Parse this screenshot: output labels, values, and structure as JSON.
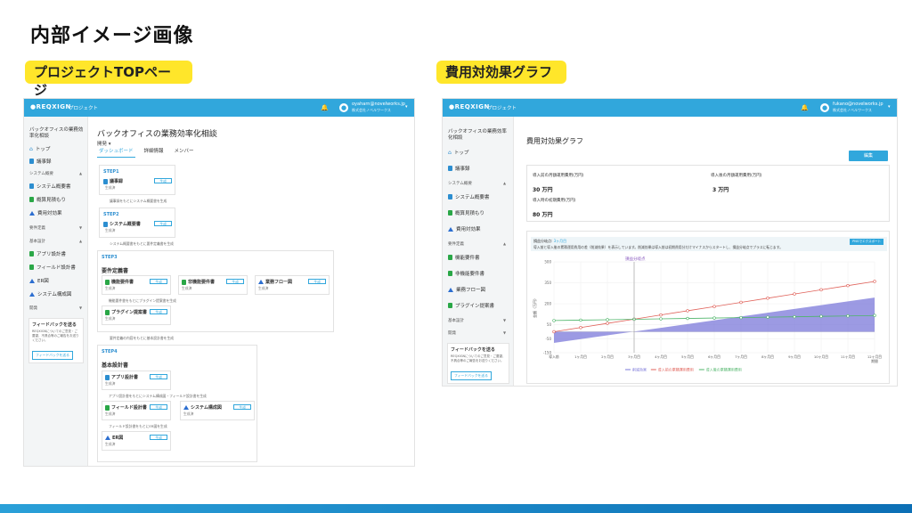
{
  "slide": {
    "title": "内部イメージ画像",
    "label_left": "プロジェクトTOPページ",
    "label_right": "費用対効果グラフ"
  },
  "app": {
    "logo": "REQXIGN",
    "header_project": "プロジェクト",
    "left_user_email": "oyaharn@novelworks.jp",
    "left_user_org": "株式会社ノベルワークス",
    "right_user_email": "fukano@novelworks.jp",
    "right_user_org": "株式会社ノベルワークス",
    "accent": "#31a7dc"
  },
  "left": {
    "sidebar": {
      "project": "バックオフィスの業務効率化相談",
      "items": [
        "トップ",
        "議事録"
      ],
      "section_system": "システム概要",
      "system_items": [
        "システム概要書",
        "概算見積もり",
        "費用対効果"
      ],
      "section_req": "要件定義",
      "section_basic": "基本設計",
      "basic_items": [
        "アプリ設計書",
        "フィールド設計書",
        "ER図",
        "システム構成図"
      ],
      "section_dev": "開発",
      "feedback_title": "フィードバックを送る",
      "feedback_text": "REQXIGNについてのご意見・ご要望、不具合等のご報告をお送りください。",
      "feedback_button": "フィードバックを送る"
    },
    "main": {
      "title": "バックオフィスの業務効率化相談",
      "stage": "開発 ▾",
      "tabs": [
        "ダッシュボード",
        "詳細情報",
        "メンバー"
      ],
      "step1": "STEP1",
      "step1_doc": "議事録",
      "step2": "STEP2",
      "step2_doc": "システム概要書",
      "step3": "STEP3",
      "step3_name": "要件定義書",
      "step3_docs": [
        "機能要件書",
        "非機能要件書",
        "業務フロー図"
      ],
      "step3_doc4": "プラグイン提案書",
      "step4": "STEP4",
      "step4_name": "基本設計書",
      "step4_docs": [
        "アプリ設計書",
        "フィールド設計書",
        "システム構成図",
        "ER図"
      ],
      "status": "生成済",
      "generate": "生成",
      "note1": "議事録をもとにシステム概要書を生成",
      "note2": "システム概要書をもとに要件定義書を生成",
      "note3": "機能要件書をもとにプラグイン提案書を生成",
      "note4": "要件定義の内容をもとに基本設計書を生成",
      "note5": "アプリ設計書をもとにシステム構成図・フィールド設計書を生成",
      "note6": "フィールド設計書をもとにER図を生成"
    }
  },
  "right": {
    "sidebar": {
      "project": "バックオフィスの業務効率化相談",
      "items": [
        "トップ",
        "議事録"
      ],
      "section_system": "システム概要",
      "system_items": [
        "システム概要書",
        "概算見積もり",
        "費用対効果"
      ],
      "section_req": "要件定義",
      "req_items": [
        "機能要件書",
        "非機能要件書",
        "業務フロー図",
        "プラグイン提案書"
      ],
      "section_basic": "基本設計",
      "section_dev": "開発",
      "feedback_title": "フィードバックを送る",
      "feedback_text": "REQXIGNについてのご意見・ご要望、不具合等のご報告をお送りください。",
      "feedback_button": "フィードバックを送る"
    },
    "main": {
      "title": "費用対効果グラフ",
      "edit_button": "編集",
      "before_label": "導入前の月額運用費用(万円)",
      "before_value": "30 万円",
      "after_label": "導入後の月額運用費用(万円)",
      "after_value": "3 万円",
      "initial_label": "導入時の初期費用(万円)",
      "initial_value": "80 万円",
      "breakeven_label": "損益分岐点:",
      "breakeven_value": "3ヶ月目",
      "info_text": "導入前と導入後の累積運用費用の差（削減効果）を表示しています。削減効果は導入前は初期費用分だけマイナスからスタートし、損益分岐点でプラスに転じます。",
      "png_button": "PNGでエクスポート"
    }
  },
  "chart_data": {
    "type": "line",
    "title": "",
    "annotation": "損益分岐点",
    "ylabel": "金額（万円）",
    "xlabel": "期間",
    "ylim": [
      -150,
      500
    ],
    "yticks": [
      "500",
      "350",
      "200",
      "50",
      "-50",
      "-150"
    ],
    "categories": [
      "導入前",
      "1ヶ月目",
      "2ヶ月目",
      "3ヶ月目",
      "4ヶ月目",
      "5ヶ月目",
      "6ヶ月目",
      "7ヶ月目",
      "8ヶ月目",
      "9ヶ月目",
      "10ヶ月目",
      "11ヶ月目",
      "12ヶ月目"
    ],
    "series": [
      {
        "name": "削減効果",
        "color": "#7b78d9",
        "values": [
          -80,
          -53,
          -26,
          1,
          28,
          55,
          82,
          109,
          136,
          163,
          190,
          217,
          244
        ]
      },
      {
        "name": "導入前の累積運用費用",
        "color": "#e0625a",
        "values": [
          0,
          30,
          60,
          90,
          120,
          150,
          180,
          210,
          240,
          270,
          300,
          330,
          360
        ]
      },
      {
        "name": "導入後の累積運用費用",
        "color": "#4fb56a",
        "values": [
          80,
          83,
          86,
          89,
          92,
          95,
          98,
          101,
          104,
          107,
          110,
          113,
          116
        ]
      }
    ],
    "breakeven_index": 3
  }
}
